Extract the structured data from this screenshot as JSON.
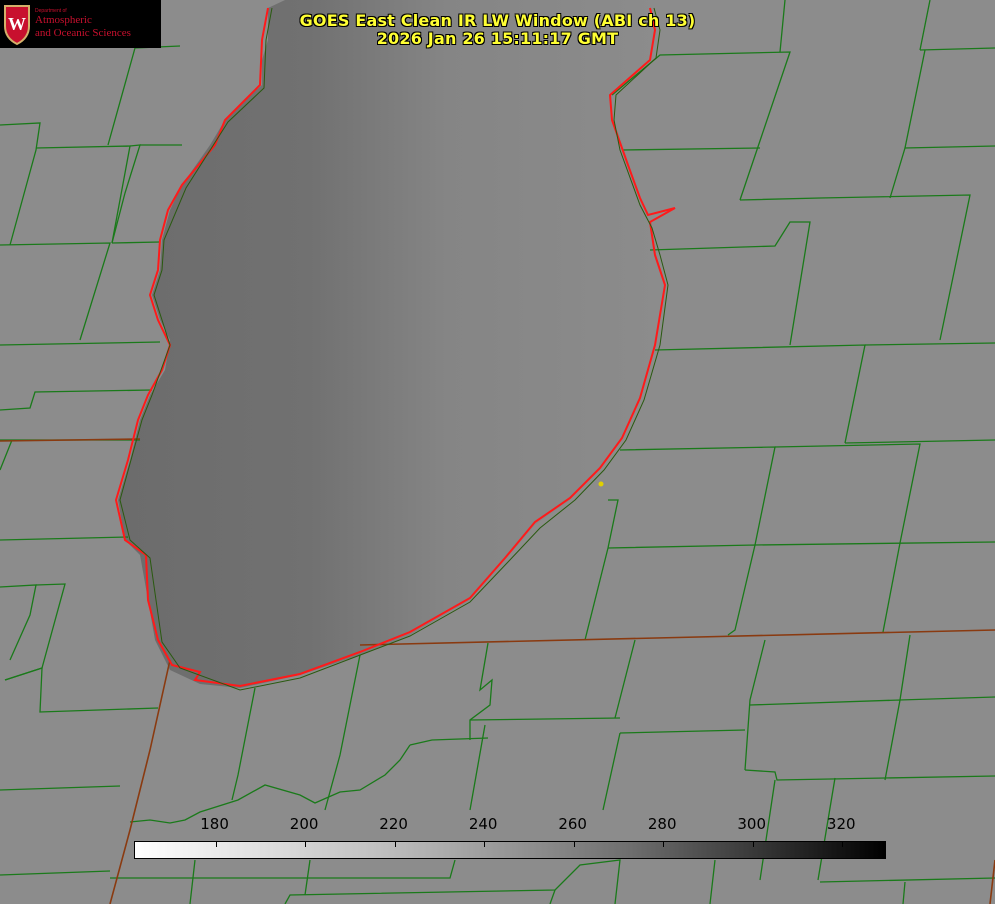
{
  "title": {
    "line1": "GOES East Clean IR LW Window (ABI ch 13)",
    "line2": "2026 Jan 26 15:11:17 GMT"
  },
  "logo": {
    "department": "Department of",
    "line1": "Atmospheric",
    "line2": "and Oceanic Sciences",
    "seal_letter": "W"
  },
  "colorbar": {
    "min": 162,
    "max": 330,
    "ticks": [
      "180",
      "200",
      "220",
      "240",
      "260",
      "280",
      "300",
      "320"
    ],
    "colors": {
      "low": "#ffffff",
      "high": "#000000"
    }
  },
  "map": {
    "colors": {
      "land": "#8c8c8c",
      "lake_dark": "#6f6f6f",
      "lake_light": "#8a8a8a",
      "county_lines": "#1a7a1a",
      "state_lines": "#8a3a10",
      "coast_red": "#ff1a1a",
      "marker": "#e0d000"
    }
  }
}
